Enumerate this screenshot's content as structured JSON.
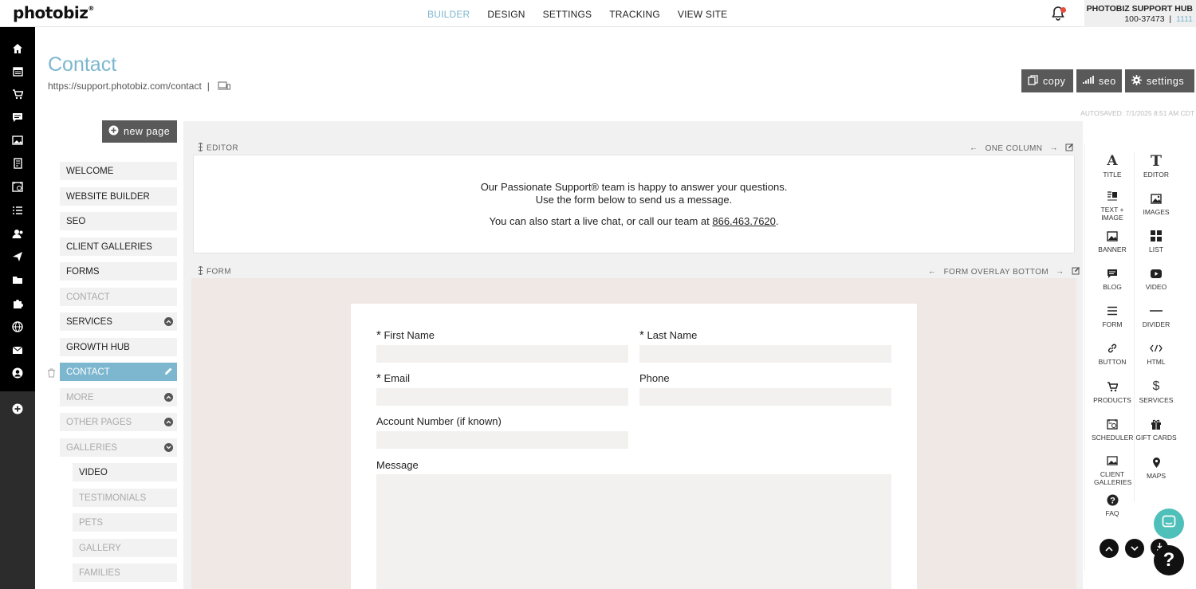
{
  "app": {
    "logo": "photobiz",
    "logo_mark": "®"
  },
  "topnav": {
    "items": [
      "BUILDER",
      "DESIGN",
      "SETTINGS",
      "TRACKING",
      "VIEW SITE"
    ],
    "active": "BUILDER"
  },
  "account": {
    "name": "PHOTOBIZ SUPPORT HUB",
    "id": "100-37473",
    "sep": "|",
    "extra": "1111"
  },
  "sidebar_icons": [
    "home-icon",
    "calendar-icon",
    "cart-icon",
    "chat-icon",
    "gallery-icon",
    "document-icon",
    "scheduler-icon",
    "list-icon",
    "users-icon",
    "send-icon",
    "folder-icon",
    "puzzle-icon",
    "globe-icon",
    "mail-icon",
    "profile-icon",
    "add-icon"
  ],
  "page": {
    "title": "Contact",
    "url": "https://support.photobiz.com/contact",
    "url_sep": "|"
  },
  "toolbar": {
    "copy": "copy",
    "seo": "seo",
    "settings": "settings"
  },
  "autosaved": "AUTOSAVED: 7/1/2025 8:51 AM CDT",
  "new_page": "new page",
  "pages": [
    {
      "label": "WELCOME",
      "state": "normal"
    },
    {
      "label": "WEBSITE BUILDER",
      "state": "normal"
    },
    {
      "label": "SEO",
      "state": "normal"
    },
    {
      "label": "CLIENT GALLERIES",
      "state": "normal"
    },
    {
      "label": "FORMS",
      "state": "normal"
    },
    {
      "label": "CONTACT",
      "state": "muted"
    },
    {
      "label": "SERVICES",
      "state": "normal",
      "chevron": "up"
    },
    {
      "label": "GROWTH HUB",
      "state": "normal"
    },
    {
      "label": "CONTACT",
      "state": "selected"
    },
    {
      "label": "MORE",
      "state": "muted",
      "chevron": "up"
    },
    {
      "label": "OTHER PAGES",
      "state": "muted",
      "chevron": "up"
    },
    {
      "label": "GALLERIES",
      "state": "muted",
      "chevron": "down"
    },
    {
      "label": "VIDEO",
      "state": "normal",
      "sub": true
    },
    {
      "label": "TESTIMONIALS",
      "state": "muted",
      "sub": true
    },
    {
      "label": "PETS",
      "state": "muted",
      "sub": true
    },
    {
      "label": "GALLERY",
      "state": "muted",
      "sub": true
    },
    {
      "label": "FAMILIES",
      "state": "muted",
      "sub": true
    }
  ],
  "editor_section": {
    "label": "EDITOR",
    "layout": "ONE COLUMN",
    "line1": "Our Passionate Support® team is happy to answer your questions.",
    "line2": "Use the form below to send us a message.",
    "line3_pre": "You can also start a live chat, or call our team at ",
    "phone": "866.463.7620",
    "line3_post": "."
  },
  "form_section": {
    "label": "FORM",
    "layout": "FORM OVERLAY BOTTOM",
    "fields": {
      "first_name": "First Name",
      "last_name": "Last Name",
      "email": "Email",
      "phone": "Phone",
      "account": "Account Number (if known)",
      "message": "Message"
    },
    "required_mark": "*"
  },
  "widgets": [
    {
      "label": "TITLE",
      "icon": "title-icon"
    },
    {
      "label": "EDITOR",
      "icon": "editor-icon"
    },
    {
      "label": "TEXT + IMAGE",
      "icon": "text-image-icon"
    },
    {
      "label": "IMAGES",
      "icon": "images-icon"
    },
    {
      "label": "BANNER",
      "icon": "banner-icon"
    },
    {
      "label": "LIST",
      "icon": "list-grid-icon"
    },
    {
      "label": "BLOG",
      "icon": "blog-icon"
    },
    {
      "label": "VIDEO",
      "icon": "video-icon"
    },
    {
      "label": "FORM",
      "icon": "form-icon"
    },
    {
      "label": "DIVIDER",
      "icon": "divider-icon"
    },
    {
      "label": "BUTTON",
      "icon": "link-icon"
    },
    {
      "label": "HTML",
      "icon": "code-icon"
    },
    {
      "label": "PRODUCTS",
      "icon": "cart-icon"
    },
    {
      "label": "SERVICES",
      "icon": "dollar-icon"
    },
    {
      "label": "SCHEDULER",
      "icon": "scheduler-icon"
    },
    {
      "label": "GIFT CARDS",
      "icon": "gift-icon"
    },
    {
      "label": "CLIENT GALLERIES",
      "icon": "client-galleries-icon"
    },
    {
      "label": "MAPS",
      "icon": "map-pin-icon"
    },
    {
      "label": "FAQ",
      "icon": "question-icon"
    }
  ],
  "help": {
    "label": "?"
  }
}
